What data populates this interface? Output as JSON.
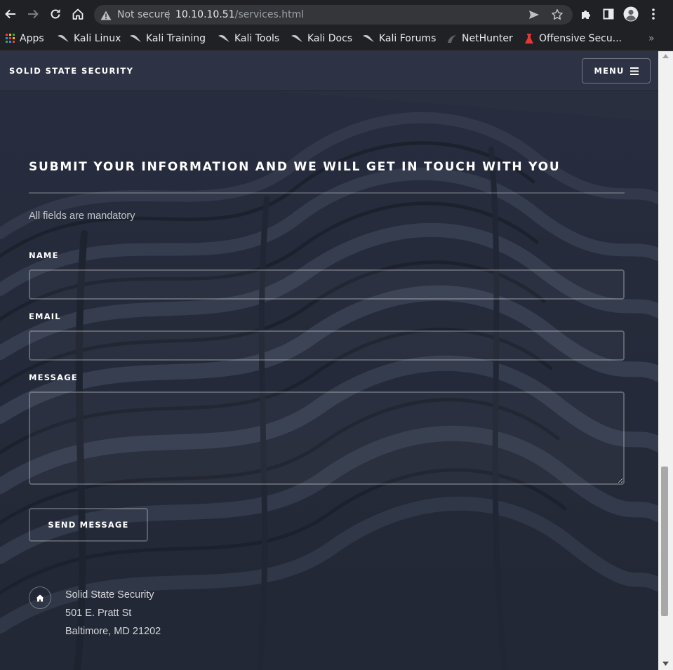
{
  "browser": {
    "security_label": "Not secure",
    "url_host": "10.10.10.51",
    "url_path": "/services.html",
    "icons": [
      "back-arrow-icon",
      "forward-arrow-icon",
      "reload-icon",
      "home-icon",
      "warning-icon",
      "send-icon",
      "star-icon",
      "extensions-icon",
      "side-panel-icon",
      "profile-icon",
      "more-vert-icon"
    ],
    "bookmarks": [
      "Apps",
      "Kali Linux",
      "Kali Training",
      "Kali Tools",
      "Kali Docs",
      "Kali Forums",
      "NetHunter",
      "Offensive Secu..."
    ],
    "overflow": "»"
  },
  "site": {
    "logo": "SOLID STATE SECURITY",
    "menu_label": "MENU"
  },
  "form": {
    "heading": "SUBMIT YOUR INFORMATION AND WE WILL GET IN TOUCH WITH YOU",
    "note": "All fields are mandatory",
    "name_label": "NAME",
    "email_label": "EMAIL",
    "message_label": "MESSAGE",
    "name_value": "",
    "email_value": "",
    "message_value": "",
    "send_label": "SEND MESSAGE"
  },
  "address": {
    "line1": "Solid State Security",
    "line2": "501 E. Pratt St",
    "line3": "Baltimore, MD 21202"
  },
  "colors": {
    "browser_bg": "#202124",
    "page_header": "#2d3244",
    "page_bg": "#2a2f3f"
  }
}
